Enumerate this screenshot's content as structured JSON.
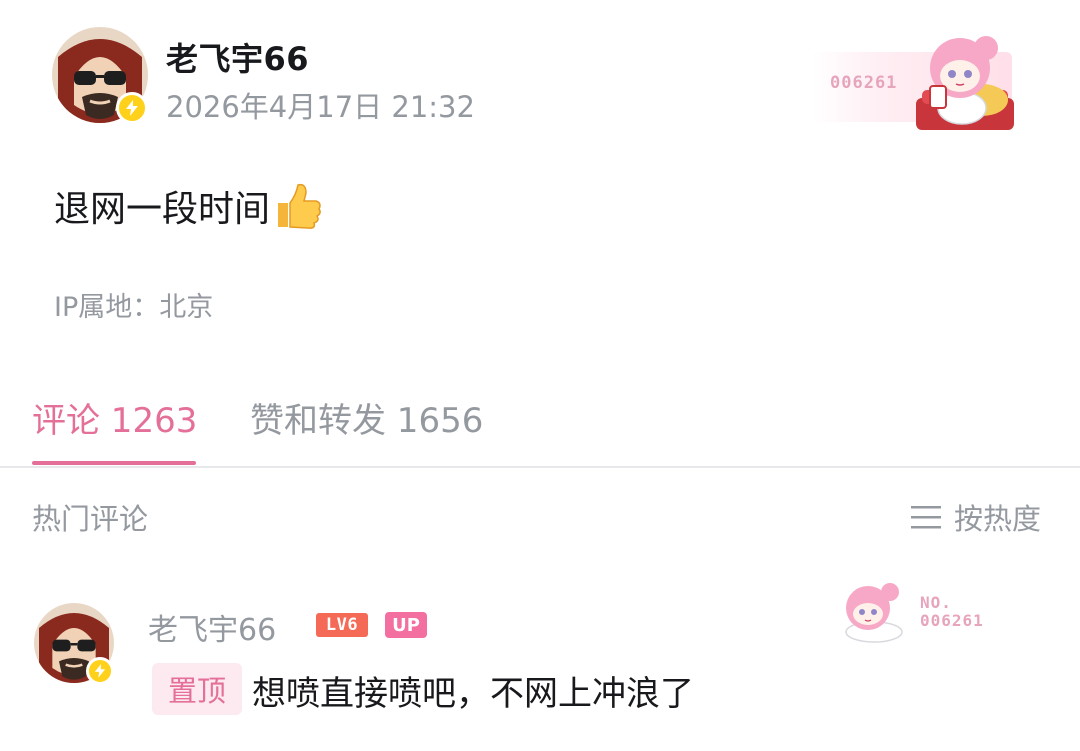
{
  "post": {
    "author_name": "老飞宇66",
    "timestamp": "2026年4月17日 21:32",
    "content": "退网一段时间",
    "content_emoji": "thumbs-up",
    "ip_location": "IP属地：北京",
    "fan_card_number": "006261"
  },
  "tabs": [
    {
      "label": "评论 1263",
      "active": true
    },
    {
      "label": "赞和转发 1656",
      "active": false
    }
  ],
  "comments_header": {
    "section_label": "热门评论",
    "sort_label": "按热度",
    "sort_icon": "menu-lines-icon"
  },
  "comment": {
    "author_name": "老飞宇66",
    "level_badge": "LV6",
    "up_badge": "UP",
    "pinned_label": "置顶",
    "text": "想喷直接喷吧，不网上冲浪了",
    "fan_no_label": "NO.",
    "fan_no_number": "006261"
  },
  "colors": {
    "accent_pink": "#e4709a",
    "muted_gray": "#9499a0",
    "text_dark": "#18191c",
    "badge_yellow": "#ffd11a",
    "level_red": "#f46a57"
  }
}
